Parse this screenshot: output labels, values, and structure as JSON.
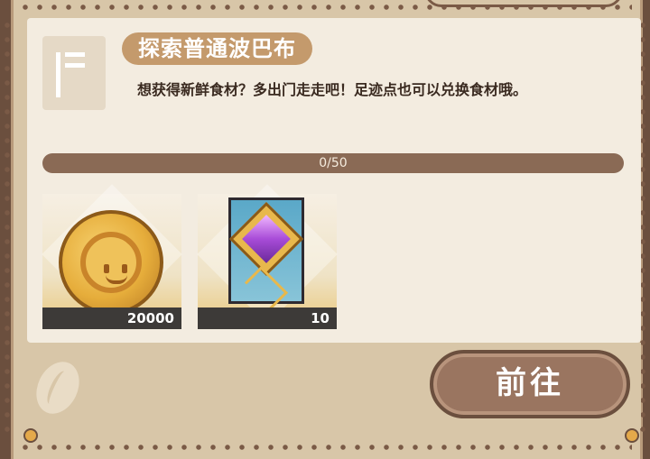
{
  "task": {
    "title": "探索普通波巴布",
    "description": "想获得新鲜食材？多出门走走吧！足迹点也可以兑换食材哦。",
    "progress_text": "0/50",
    "progress_value": 0.0
  },
  "rewards": [
    {
      "icon": "gold-coin-icon",
      "count": "20000"
    },
    {
      "icon": "gem-card-icon",
      "count": "10"
    }
  ],
  "actions": {
    "go_label": "前往"
  },
  "colors": {
    "frame": "#6b4f3e",
    "card_bg": "#f3ece0",
    "title_pill": "#c49a6c",
    "progress_bg": "#8a6a55",
    "button_bg": "#9a7560"
  }
}
